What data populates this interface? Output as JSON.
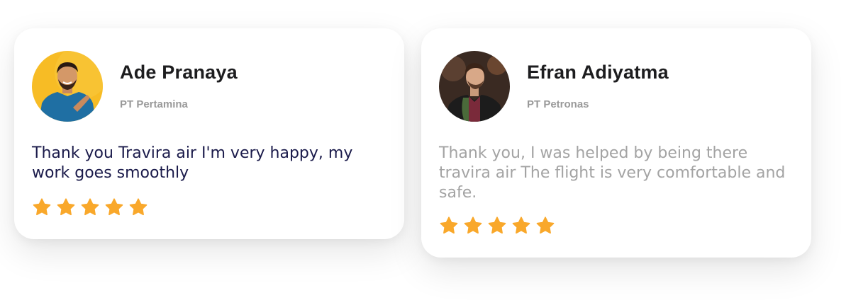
{
  "reviews": [
    {
      "name": "Ade Pranaya",
      "company": "PT Pertamina",
      "quote": "Thank you Travira air I'm very happy, my work goes smoothly",
      "rating": 5,
      "rating_max": 5
    },
    {
      "name": "Efran Adiyatma",
      "company": "PT Petronas",
      "quote": "Thank you, I was helped by being there travira air The flight is very comfortable and safe.",
      "rating": 5,
      "rating_max": 5
    }
  ],
  "colors": {
    "star": "#F9A82B",
    "name": "#1d1d1f",
    "company": "#9a9a9a",
    "quote_dark": "#1a1a4a",
    "quote_light": "#a3a3a3",
    "avatar1_bg": "#F7BC25",
    "avatar2_bg": "#3a2a22"
  }
}
